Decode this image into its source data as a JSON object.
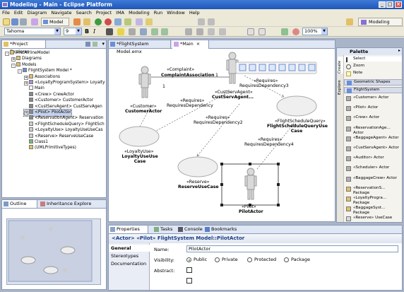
{
  "window": {
    "title": "Modeling - Main - Eclipse Platform"
  },
  "menu": [
    "File",
    "Edit",
    "Diagram",
    "Navigate",
    "Search",
    "Project",
    "IMA",
    "Modeling",
    "Run",
    "Window",
    "Help"
  ],
  "toolbar": {
    "model_label": "Model",
    "font": "Tahoma",
    "font_size": "9",
    "zoom": "100%",
    "bold": "B",
    "italic": "I",
    "perspective": "Modeling"
  },
  "project_explorer": {
    "tab": "*Project Explorer",
    "items": [
      {
        "label": "FirstAirlineModel",
        "level": 0,
        "exp": "-",
        "icon": "#e2c068"
      },
      {
        "label": "Diagrams",
        "level": 1,
        "exp": "+",
        "icon": "#e2c068"
      },
      {
        "label": "Models",
        "level": 1,
        "exp": "-",
        "icon": "#e2c068"
      },
      {
        "label": "FlightSystem Model *",
        "level": 2,
        "exp": "-",
        "icon": "#6b8fd6"
      },
      {
        "label": "Associations",
        "level": 3,
        "exp": "+",
        "icon": "#e2c068"
      },
      {
        "label": "<LoyaltyProgramSystem> Loyalty",
        "level": 3,
        "exp": "+",
        "icon": "#a98fd8"
      },
      {
        "label": "Main",
        "level": 3,
        "exp": "",
        "icon": "#ffffff"
      },
      {
        "label": "<Crew> CrewActor",
        "level": 3,
        "exp": "",
        "icon": "#888888"
      },
      {
        "label": "<Customer> CustomerActor",
        "level": 3,
        "exp": "",
        "icon": "#888888"
      },
      {
        "label": "<CustServAgent> CustServAgen",
        "level": 3,
        "exp": "",
        "icon": "#888888"
      },
      {
        "label": "<Pilot> PilotActor",
        "level": 3,
        "exp": "+",
        "icon": "#888888",
        "selected": true
      },
      {
        "label": "<ReservationAgent> Reservation",
        "level": 3,
        "exp": "",
        "icon": "#888888"
      },
      {
        "label": "<FlightScheduleQuery> FlightSch",
        "level": 3,
        "exp": "",
        "icon": "#d0d0d0"
      },
      {
        "label": "<LoyaltyUse> LoyaltyUseUseCas",
        "level": 3,
        "exp": "",
        "icon": "#d0d0d0"
      },
      {
        "label": "<Reserve> ReserveUseCase",
        "level": 3,
        "exp": "",
        "icon": "#d0d0d0"
      },
      {
        "label": "Class1",
        "level": 3,
        "exp": "",
        "icon": "#6fbf6f"
      },
      {
        "label": "(UMLPrimitiveTypes)",
        "level": 3,
        "exp": "",
        "icon": "#e2c068"
      }
    ]
  },
  "outline": {
    "tabs": [
      "Outline",
      "Inheritance Explore"
    ]
  },
  "editor": {
    "tabs": [
      "*FlightSystem Model.emx",
      "*Main"
    ]
  },
  "diagram": {
    "actors": [
      {
        "stereo": "«Customer»",
        "name": "CustomerActor"
      },
      {
        "stereo": "«CustServAgent»",
        "name": "CustServAgent..."
      },
      {
        "stereo": "«Pilot»",
        "name": "PilotActor"
      }
    ],
    "usecases": [
      {
        "stereo": "«LoyaltyUse»",
        "name": "LoyaltyUseUse Case"
      },
      {
        "stereo": "«Reserve»",
        "name": "ReserveUseCase"
      },
      {
        "stereo": "«FlightScheduleQuery»",
        "name": "FlightScheduleQueryUse Case"
      }
    ],
    "assoc": {
      "stereo": "«Complaint»",
      "name": "ComplaintAssociation",
      "mult_left": "1",
      "mult_right": "1"
    },
    "deps": [
      {
        "stereo": "«Requires»",
        "name": "RequiresDependency"
      },
      {
        "stereo": "«Requires»",
        "name": "RequiresDependency2"
      },
      {
        "stereo": "«Requires»",
        "name": "RequiresDependency3"
      },
      {
        "stereo": "«Requires»",
        "name": "RequiresDependency4"
      }
    ]
  },
  "palette": {
    "title": "Palette",
    "side_tabs": [
      "Create",
      "Explore"
    ],
    "tools": [
      "Select",
      "Zoom",
      "Note"
    ],
    "drawers": [
      "Geometric Shapes",
      "FlightSystem"
    ],
    "items": [
      "«Customer» Actor",
      "«Pilot» Actor",
      "«Crew» Actor",
      "«ReservationAge... Actor",
      "«BaggageAgent» Actor",
      "«CustServAgent» Actor",
      "«Auditor» Actor",
      "«Scheduler» Actor",
      "«BaggageCrew» Actor",
      "«ReservationS... Package",
      "«LoyaltyProgra... Package",
      "«BaggageSyst... Package",
      "«Reserve» UseCase"
    ]
  },
  "bottom": {
    "tabs": [
      "Properties",
      "Tasks",
      "Console",
      "Bookmarks"
    ],
    "heading": "<Actor> «Pilot» FlightSystem Model::PilotActor",
    "sections": [
      "General",
      "Stereotypes",
      "Documentation"
    ],
    "name_label": "Name:",
    "name_value": "PilotActor",
    "visibility_label": "Visibility:",
    "visibility_options": [
      "Public",
      "Private",
      "Protected",
      "Package"
    ],
    "visibility_selected": "Public",
    "abstract_label": "Abstract:"
  }
}
